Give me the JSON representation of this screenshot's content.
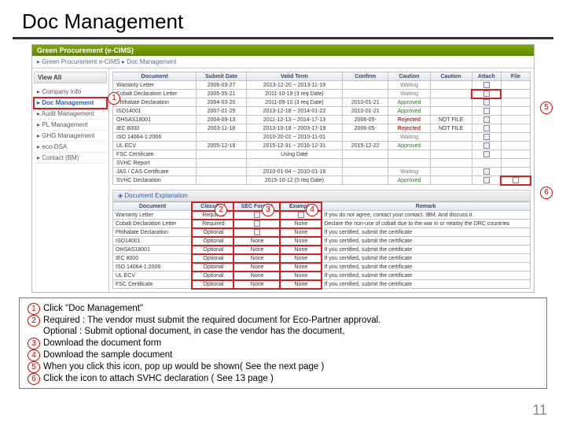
{
  "title": "Doc Management",
  "app_header": "Green Procurement (e-CIMS)",
  "breadcrumb": "▸ Green Procurement e-CIMS ▸ Doc Management",
  "sidebar": {
    "header": "View All",
    "items": [
      {
        "label": "Company Info"
      },
      {
        "label": "Doc Management",
        "active": true
      },
      {
        "label": "Audit Management"
      },
      {
        "label": "PL Management"
      },
      {
        "label": "GHG Management"
      },
      {
        "label": "eco-DSA"
      },
      {
        "label": "Contact (BM)"
      }
    ]
  },
  "top_table": {
    "headers": [
      "Document",
      "Submit Date",
      "Valid Term",
      "Confirm",
      "Caution",
      "Caution",
      "Attach",
      "File"
    ],
    "rows": [
      {
        "doc": "Warranty Letter",
        "submit": "2006-03-27",
        "valid": "2013-12-20 ~ 2013-11-19",
        "confirm": "",
        "caution": "Waiting",
        "caution2": "",
        "attach": "@",
        "file": ""
      },
      {
        "doc": "Cobalt Declaration Letter",
        "submit": "2005-05-21",
        "valid": "2011-10-19 (3 req Date)",
        "confirm": "",
        "caution": "Waiting",
        "caution2": "",
        "attach": "@",
        "file": ""
      },
      {
        "doc": "Phthalate Declaration",
        "submit": "2004-03-20",
        "valid": "2011-09-10 (3 req Date)",
        "confirm": "2010-01-21",
        "caution": "Approved",
        "caution2": "",
        "attach": "@",
        "file": ""
      },
      {
        "doc": "ISO14001",
        "submit": "2007-01-25",
        "valid": "2013-12-18 ~ 2014-01-22",
        "confirm": "2010-01-21",
        "caution": "Approved",
        "caution2": "",
        "attach": "@",
        "file": ""
      },
      {
        "doc": "OHSAS18001",
        "submit": "2004-09-13",
        "valid": "2011-12-13 ~ 2014-17-13",
        "confirm": "2006-05-",
        "caution": "Rejected",
        "caution2": "NOT FILE",
        "attach": "@",
        "file": ""
      },
      {
        "doc": "IEC 8000",
        "submit": "2003-11-18",
        "valid": "2013-10-18 ~ 2003-17-19",
        "confirm": "2006-05-",
        "caution": "Rejected",
        "caution2": "NOT FILE",
        "attach": "@",
        "file": ""
      },
      {
        "doc": "ISO 14064-1:2006",
        "submit": "",
        "valid": "2010-20-01 ~ 2010-11-01",
        "confirm": "",
        "caution": "Waiting",
        "caution2": "",
        "attach": "@",
        "file": ""
      },
      {
        "doc": "UL ECV",
        "submit": "2005-12-18",
        "valid": "2015-12-31 ~ 2016-12-31",
        "confirm": "2015-12-22",
        "caution": "Approved",
        "caution2": "",
        "attach": "@",
        "file": ""
      },
      {
        "doc": "FSC Certificate",
        "submit": "",
        "valid": "Using Date",
        "confirm": "",
        "caution": "",
        "caution2": "",
        "attach": "@",
        "file": ""
      },
      {
        "doc": "SVHC Report",
        "submit": "",
        "valid": "",
        "confirm": "",
        "caution": "",
        "caution2": "",
        "attach": "",
        "file": ""
      },
      {
        "doc": "JAS / CAS Certificate",
        "submit": "",
        "valid": "2010-01-04 ~ 2010-01-16",
        "confirm": "",
        "caution": "Waiting",
        "caution2": "",
        "attach": "@",
        "file": ""
      },
      {
        "doc": "SVHC Declaration",
        "submit": "",
        "valid": "2015-10-12 (5 req Date)",
        "confirm": "",
        "caution": "Approved",
        "caution2": "",
        "attach": "@",
        "file": "↓"
      }
    ]
  },
  "section_header": "◈ Document Explanation",
  "exp_table": {
    "headers": [
      "Document",
      "Class/Rel",
      "SEC Format",
      "Example",
      "Remark"
    ],
    "rows": [
      {
        "doc": "Warranty Letter",
        "cls": "Required",
        "fmt": "exist",
        "ex": "exist",
        "rem": "If you do not agree, contact your contact. IBM. And discuss it."
      },
      {
        "doc": "Cobalt Declaration Letter",
        "cls": "Required",
        "fmt": "exist",
        "ex": "None",
        "rem": "Declare the non-use of cobalt due to the war in or nearby the DRC countries"
      },
      {
        "doc": "Phthalate Declaration",
        "cls": "Optional",
        "fmt": "exist",
        "ex": "None",
        "rem": "If you certified, submit the certificate"
      },
      {
        "doc": "ISO14001",
        "cls": "Optional",
        "fmt": "None",
        "ex": "None",
        "rem": "If you certified, submit the certificate"
      },
      {
        "doc": "OHSAS18001",
        "cls": "Optional",
        "fmt": "None",
        "ex": "None",
        "rem": "If you certified, submit the certificate"
      },
      {
        "doc": "IEC 8000",
        "cls": "Optional",
        "fmt": "None",
        "ex": "None",
        "rem": "If you certified, submit the certificate"
      },
      {
        "doc": "ISO 14064-1:2006",
        "cls": "Optional",
        "fmt": "None",
        "ex": "None",
        "rem": "If you certified, submit the certificate"
      },
      {
        "doc": "UL ECV",
        "cls": "Optional",
        "fmt": "None",
        "ex": "None",
        "rem": "If you certified, submit the certificate"
      },
      {
        "doc": "FSC Certificate",
        "cls": "Optional",
        "fmt": "None",
        "ex": "None",
        "rem": "If you certified, submit the certificate"
      }
    ]
  },
  "callouts": {
    "c1": "1",
    "c2": "2",
    "c3": "3",
    "c4": "4",
    "c5": "5",
    "c6": "6"
  },
  "instructions": [
    {
      "n": "1",
      "text": "Click \"Doc Management\""
    },
    {
      "n": "2",
      "text": "Required : The vendor must submit the required document for Eco-Partner approval.\nOptional : Submit optional document, in case the vendor has the document,"
    },
    {
      "n": "3",
      "text": "Download the document form"
    },
    {
      "n": "4",
      "text": "Download the sample document"
    },
    {
      "n": "5",
      "text": "When you click this icon, pop up would be shown( See the next page )"
    },
    {
      "n": "6",
      "text": "Click the icon to attach SVHC declaration ( See 13 page )"
    }
  ],
  "page_number": "11"
}
